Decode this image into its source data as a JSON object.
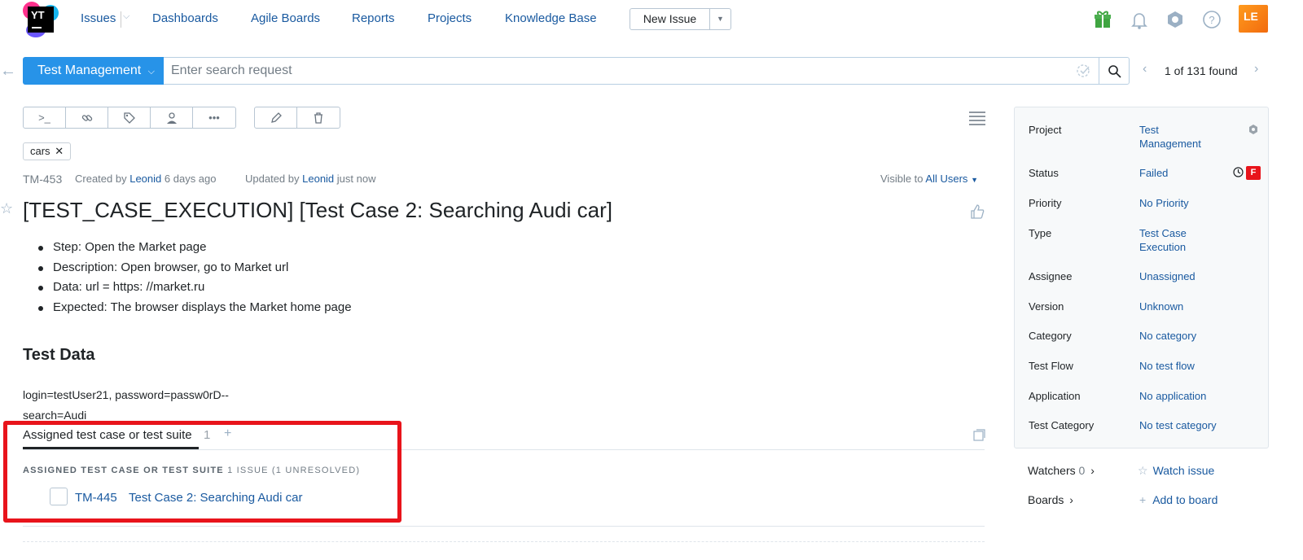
{
  "header": {
    "nav": {
      "issues": "Issues",
      "dashboards": "Dashboards",
      "agile_boards": "Agile Boards",
      "reports": "Reports",
      "projects": "Projects",
      "knowledge_base": "Knowledge Base"
    },
    "logo_text": "YT",
    "new_issue": "New Issue",
    "avatar_initials": "LE"
  },
  "search": {
    "context": "Test Management",
    "placeholder": "Enter search request",
    "found": "1 of 131 found"
  },
  "issue": {
    "tag": "cars",
    "id": "TM-453",
    "created_prefix": "Created by",
    "created_by": "Leonid",
    "created_when": "6 days ago",
    "updated_prefix": "Updated by",
    "updated_by": "Leonid",
    "updated_when": "just now",
    "visible_prefix": "Visible to",
    "visible_to": "All Users",
    "title": "[TEST_CASE_EXECUTION] [Test Case 2: Searching Audi car]",
    "steps": [
      "Step: Open the Market page",
      "Description: Open browser, go to Market url",
      "Data: url = https: //market.ru",
      "Expected: The browser displays the Market home page"
    ],
    "test_data_heading": "Test Data",
    "test_data_lines": [
      "login=testUser21, password=passw0rD--",
      "search=Audi"
    ]
  },
  "links": {
    "tab_label": "Assigned test case or test suite",
    "tab_count": "1",
    "tab_add": "+",
    "section_heading": "ASSIGNED TEST CASE OR TEST SUITE",
    "section_count": "1 ISSUE (1 UNRESOLVED)",
    "items": [
      {
        "id": "TM-445",
        "summary": "Test Case 2: Searching Audi car"
      }
    ]
  },
  "sidebar": {
    "fields": [
      {
        "name": "Project",
        "value": "Test Management"
      },
      {
        "name": "Status",
        "value": "Failed"
      },
      {
        "name": "Priority",
        "value": "No Priority"
      },
      {
        "name": "Type",
        "value": "Test Case Execution"
      },
      {
        "name": "Assignee",
        "value": "Unassigned"
      },
      {
        "name": "Version",
        "value": "Unknown"
      },
      {
        "name": "Category",
        "value": "No category"
      },
      {
        "name": "Test Flow",
        "value": "No test flow"
      },
      {
        "name": "Application",
        "value": "No application"
      },
      {
        "name": "Test Category",
        "value": "No test category"
      }
    ],
    "status_badge": "F",
    "watchers_label": "Watchers",
    "watchers_count": "0",
    "watch_issue": "Watch issue",
    "boards_label": "Boards",
    "add_to_board": "Add to board"
  },
  "colors": {
    "accent": "#2793e8",
    "link": "#1a5aa0",
    "status_failed": "#e8141b",
    "highlight_box": "#e8141b"
  },
  "icons": [
    "gift-icon",
    "bell-icon",
    "hub-icon",
    "help-icon",
    "search-icon",
    "command-icon",
    "link-icon",
    "tag-icon",
    "user-icon",
    "more-icon",
    "edit-icon",
    "delete-icon",
    "list-icon",
    "thumbs-up-icon",
    "star-icon",
    "clock-icon"
  ]
}
